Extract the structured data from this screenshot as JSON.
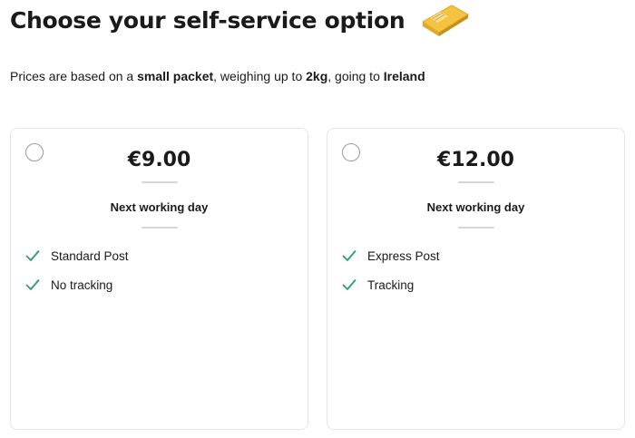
{
  "page": {
    "title": "Choose your self-service option",
    "subtitle_parts": [
      {
        "text": "Prices are based on a ",
        "bold": false
      },
      {
        "text": "small packet",
        "bold": true
      },
      {
        "text": ", weighing up to ",
        "bold": false
      },
      {
        "text": "2kg",
        "bold": true
      },
      {
        "text": ", going to ",
        "bold": false
      },
      {
        "text": "Ireland",
        "bold": true
      }
    ]
  },
  "icons": {
    "packet": "parcel-icon",
    "check": "check-icon",
    "check_color": "#2a9d6f",
    "packet_color": "#f5c342"
  },
  "options": [
    {
      "price": "€9.00",
      "delivery": "Next working day",
      "features": [
        "Standard Post",
        "No tracking"
      ],
      "selected": false
    },
    {
      "price": "€12.00",
      "delivery": "Next working day",
      "features": [
        "Express Post",
        "Tracking"
      ],
      "selected": false
    }
  ]
}
